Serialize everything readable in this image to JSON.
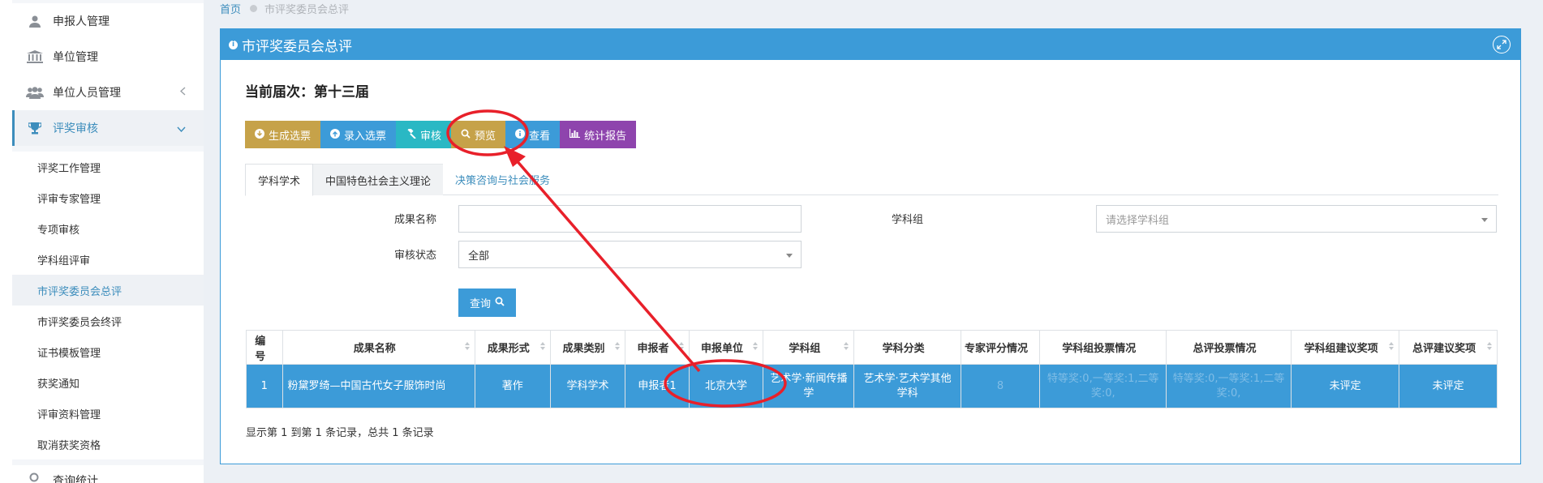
{
  "sidebar": {
    "top_items": [
      {
        "label": "申报人管理",
        "icon": "user-icon"
      },
      {
        "label": "单位管理",
        "icon": "bank-icon"
      },
      {
        "label": "单位人员管理",
        "icon": "users-icon"
      }
    ],
    "active_item": {
      "label": "评奖审核",
      "icon": "trophy-icon"
    },
    "sub_items": [
      "评奖工作管理",
      "评审专家管理",
      "专项审核",
      "学科组评审",
      "市评奖委员会总评",
      "市评奖委员会终评",
      "证书模板管理",
      "获奖通知",
      "评审资料管理",
      "取消获奖资格"
    ],
    "selected_sub": "市评奖委员会总评",
    "partial_item": "查询统计"
  },
  "breadcrumb": {
    "home": "首页",
    "current": "市评奖委员会总评"
  },
  "panel": {
    "title": "市评奖委员会总评",
    "round_label": "当前届次：第十三届"
  },
  "toolbar": {
    "buttons": [
      {
        "label": "生成选票",
        "color": "#c6a249"
      },
      {
        "label": "录入选票",
        "color": "#3c9bd8"
      },
      {
        "label": "审核",
        "color": "#2ab8c4"
      },
      {
        "label": "预览",
        "color": "#c6a249"
      },
      {
        "label": "查看",
        "color": "#3c9bd8"
      },
      {
        "label": "统计报告",
        "color": "#8e44ad"
      }
    ]
  },
  "tabs": [
    "学科学术",
    "中国特色社会主义理论",
    "决策咨询与社会服务"
  ],
  "filters": {
    "name_label": "成果名称",
    "name_value": "",
    "status_label": "审核状态",
    "status_value": "全部",
    "group_label": "学科组",
    "group_placeholder": "请选择学科组",
    "query_label": "查询"
  },
  "table": {
    "headers": [
      "编号",
      "成果名称",
      "成果形式",
      "成果类别",
      "申报者",
      "申报单位",
      "学科组",
      "学科分类",
      "专家评分情况",
      "学科组投票情况",
      "总评投票情况",
      "学科组建议奖项",
      "总评建议奖项"
    ],
    "rows": [
      [
        "1",
        "粉黛罗绮—中国古代女子服饰时尚",
        "著作",
        "学科学术",
        "申报者1",
        "北京大学",
        "艺术学·新闻传播学",
        "艺术学·艺术学其他学科",
        "8",
        "特等奖:0,一等奖:1,二等奖:0,",
        "特等奖:0,一等奖:1,二等奖:0,",
        "未评定",
        "未评定"
      ]
    ]
  },
  "footer_text": "显示第 1 到第 1 条记录，总共 1 条记录",
  "annotation_color": "#e8202a"
}
